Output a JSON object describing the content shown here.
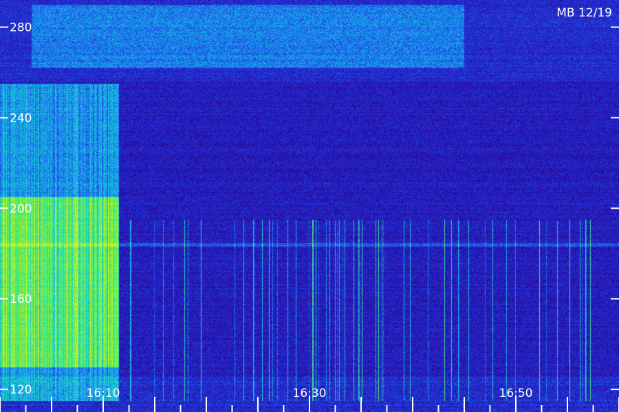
{
  "chart_data": {
    "type": "heatmap",
    "title": "MB 12/19",
    "xlabel": "",
    "ylabel": "",
    "x_ticks": [
      "16:10",
      "16:30",
      "16:50"
    ],
    "x_tick_minutes": [
      10,
      30,
      50
    ],
    "xlim_minutes": [
      0,
      60
    ],
    "y_ticks": [
      280,
      240,
      200,
      160,
      120
    ],
    "ylim": [
      110,
      292
    ],
    "colormap": [
      "#1a0050",
      "#2a10b0",
      "#1e40e0",
      "#18a0f0",
      "#20e0c0",
      "#60f040",
      "#e0f020"
    ],
    "grid": false,
    "features": [
      {
        "label": "bright broadband emission",
        "x_minutes": [
          0,
          11.5
        ],
        "y_range": [
          115,
          255
        ]
      },
      {
        "label": "strongest band",
        "x_minutes": [
          0,
          11.5
        ],
        "y_range": [
          130,
          205
        ]
      },
      {
        "label": "upper band",
        "x_minutes": [
          3,
          45
        ],
        "y_range": [
          262,
          290
        ]
      },
      {
        "label": "narrow line",
        "y": 184
      },
      {
        "label": "vertical bursts",
        "x_minutes": [
          12,
          60
        ],
        "y_range": [
          115,
          195
        ]
      }
    ]
  },
  "colors": {
    "background": "#1a0050",
    "tick_color": "#ffffff",
    "label_color": "#ffffff"
  }
}
